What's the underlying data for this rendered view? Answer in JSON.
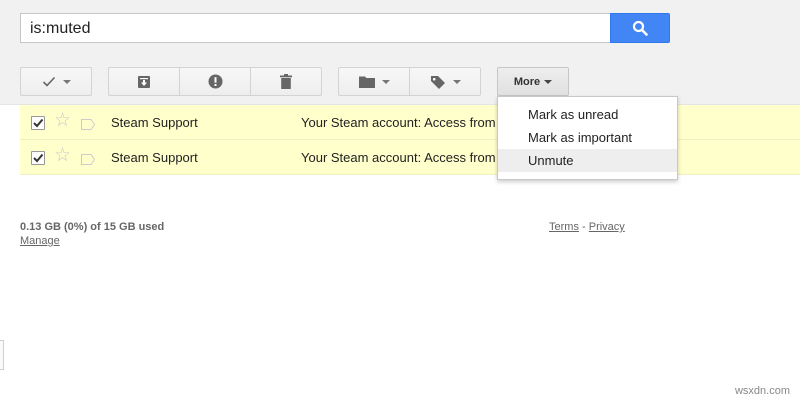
{
  "search": {
    "query": "is:muted",
    "button_icon": "search-icon",
    "button_color": "#4285f4"
  },
  "toolbar": {
    "select_icon": "checkbox-icon",
    "archive_icon": "archive-icon",
    "spam_icon": "report-spam-icon",
    "delete_icon": "trash-icon",
    "move_icon": "folder-icon",
    "labels_icon": "label-icon",
    "more_label": "More"
  },
  "more_menu": {
    "items": [
      {
        "label": "Mark as unread"
      },
      {
        "label": "Mark as important"
      },
      {
        "label": "Unmute",
        "highlighted": true
      }
    ]
  },
  "emails": [
    {
      "sender": "Steam Support",
      "subject": "Your Steam account: Access from",
      "checked": true,
      "starred": false
    },
    {
      "sender": "Steam Support",
      "subject": "Your Steam account: Access from",
      "checked": true,
      "starred": false
    }
  ],
  "footer": {
    "storage": "0.13 GB (0%) of 15 GB used",
    "manage": "Manage",
    "terms": "Terms",
    "separator": " - ",
    "privacy": "Privacy"
  },
  "watermark": "wsxdn.com",
  "colors": {
    "selected_row": "#ffffcc",
    "toolbar_bg": "#f1f1f1"
  }
}
